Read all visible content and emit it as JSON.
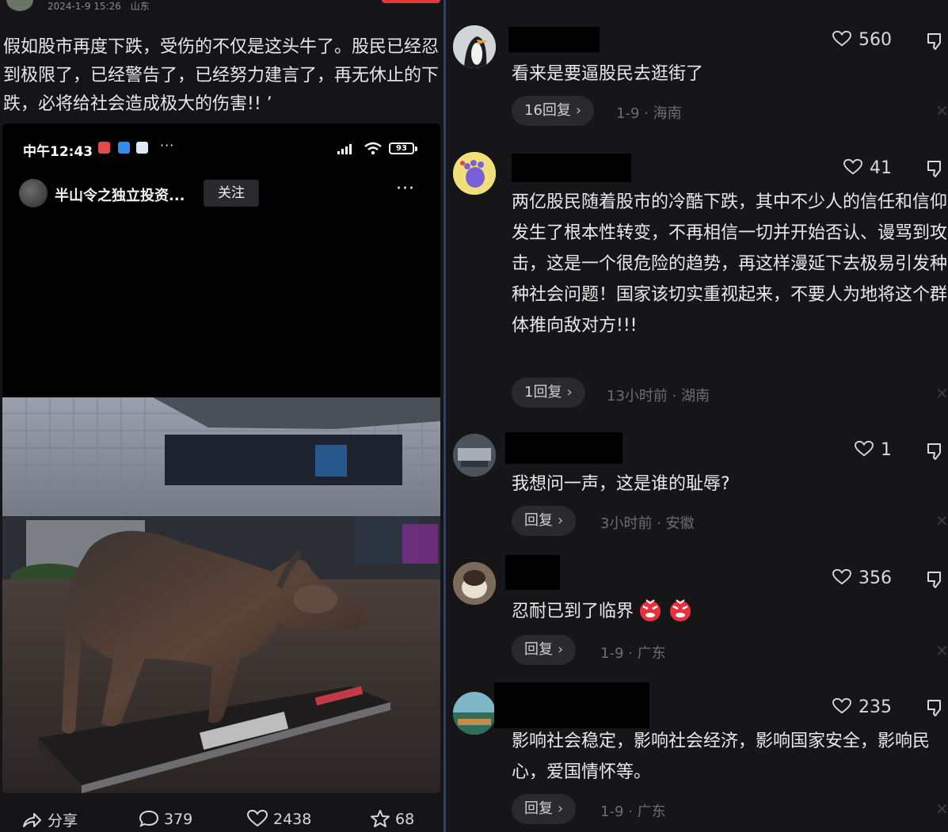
{
  "post": {
    "date": "2024-1-9 15:26",
    "location": "山东",
    "text": "假如股市再度下跌，受伤的不仅是这头牛了。股民已经忍到极限了，已经警告了，已经努力建言了，再无休止的下跌，必将给社会造成极大的伤害!! ’"
  },
  "screenshot": {
    "time": "中午12:43",
    "more": "···",
    "battery": "93",
    "account_name": "半山令之独立投资...",
    "follow_label": "关注",
    "menu": "···"
  },
  "actions": {
    "share_label": "分享",
    "comments": "379",
    "likes": "2438",
    "favorites": "68"
  },
  "comments": [
    {
      "text": "看来是要逼股民去逛街了",
      "likes": "560",
      "reply_label": "16回复",
      "date": "1-9",
      "location": "海南"
    },
    {
      "text": "两亿股民随着股市的冷酷下跌，其中不少人的信任和信仰发生了根本性转变，不再相信一切并开始否认、谩骂到攻击，这是一个很危险的趋势，再这样漫延下去极易引发种种社会问题！国家该切实重视起来，不要人为地将这个群体推向敌对方!!!",
      "likes": "41",
      "reply_label": "1回复",
      "date": "13小时前",
      "location": "湖南"
    },
    {
      "text": "我想问一声，这是谁的耻辱?",
      "likes": "1",
      "reply_label": "回复",
      "date": "3小时前",
      "location": "安徽"
    },
    {
      "text": "忍耐已到了临界",
      "likes": "356",
      "reply_label": "回复",
      "date": "1-9",
      "location": "广东"
    },
    {
      "text": "影响社会稳定，影响社会经济，影响国家安全，影响民心，爱国情怀等。",
      "likes": "235",
      "reply_label": "回复",
      "date": "1-9",
      "location": "广东"
    }
  ],
  "meta_separator": "·",
  "chevron": "›",
  "close_glyph": "✕",
  "colors": {
    "follow_bg": "#2a2a2d",
    "accent_red": "#e8343c",
    "divider": "#33415e"
  },
  "icons": [
    "share-icon",
    "comment-icon",
    "heart-icon",
    "star-icon",
    "dislike-icon",
    "close-icon",
    "chevron-right-icon",
    "signal-icon",
    "wifi-icon",
    "battery-icon",
    "angry-emoji-icon"
  ]
}
